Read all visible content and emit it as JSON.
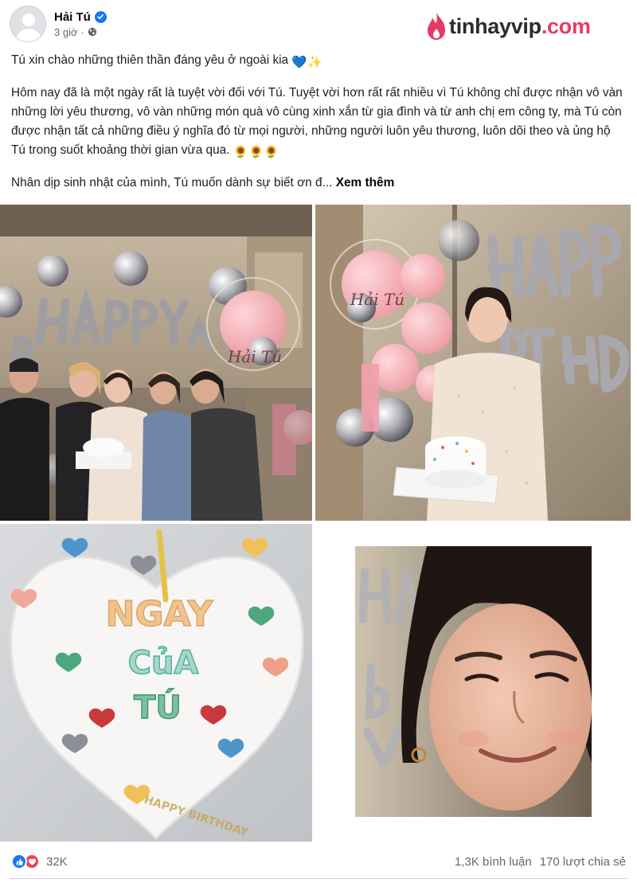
{
  "post": {
    "author": "Hải Tú",
    "time": "3 giờ",
    "verified": true,
    "privacy_icon": "globe-icon"
  },
  "watermark": {
    "brand": "tinhayvip",
    "domain": ".com",
    "brand_color": "#2b2b2b",
    "accent_color": "#e83a66"
  },
  "content": {
    "line1": "Tú xin chào những thiên thần đáng yêu ở ngoài kia",
    "line1_emoji": "💙✨",
    "paragraph2": "Hôm nay đã là một ngày rất là tuyệt vời đối với Tú. Tuyệt vời hơn rất rất nhiều vì Tú không chỉ được nhận vô vàn những lời yêu thương, vô vàn những món quà vô cùng xinh xắn từ gia đình và từ anh chị em công ty, mà Tú còn được nhận tất cả những điều ý nghĩa đó từ mọi người, những người luôn yêu thương, luôn dõi theo và ủng hộ Tú trong suốt khoảng thời gian vừa qua.",
    "paragraph2_emoji": "🌻🌻🌻",
    "paragraph3": "Nhân dịp sinh nhật của mình, Tú muốn dành sự biết ơn đ...",
    "see_more": "Xem thêm"
  },
  "photos": {
    "balloon_name": "Hải Tú",
    "cake_text_line1": "NGAY",
    "cake_text_line2": "CủA",
    "cake_text_line3": "TÚ",
    "cake_bottom_text": "HAPPY BIRTHDAY",
    "foil_text": "HAPPY BIRTHDAY"
  },
  "footer": {
    "reaction_count": "32K",
    "comments": "1,3K bình luận",
    "shares": "170 lượt chia sẻ"
  },
  "colors": {
    "facebook_blue": "#1877f2",
    "love_red": "#f33e58",
    "secondary_text": "#65676b"
  }
}
